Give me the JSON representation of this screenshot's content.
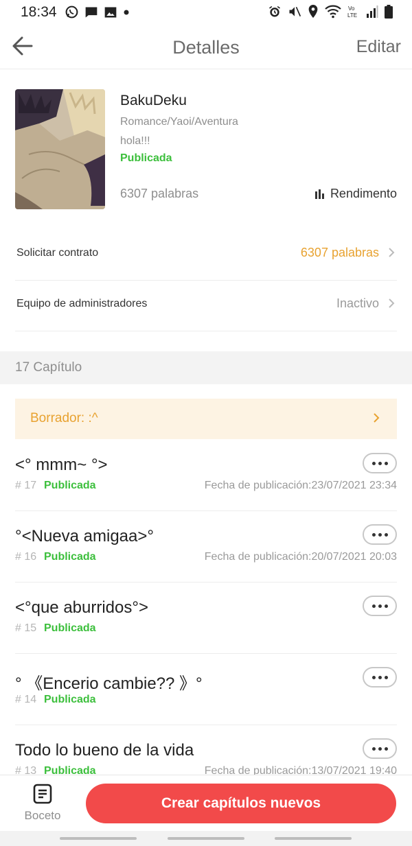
{
  "status_bar": {
    "time": "18:34",
    "left_icons": [
      "whatsapp-icon",
      "message-icon",
      "gallery-icon",
      "dot-icon"
    ],
    "right_icons": [
      "alarm-icon",
      "mute-icon",
      "location-icon",
      "wifi-icon",
      "volte-icon",
      "signal-icon",
      "battery-icon"
    ]
  },
  "header": {
    "title": "Detalles",
    "edit_label": "Editar",
    "back_icon": "arrow-left-icon"
  },
  "book": {
    "title": "BakuDeku",
    "genre": "Romance/Yaoi/Aventura",
    "description": "hola!!!",
    "status": "Publicada",
    "word_count": "6307 palabras",
    "performance_label": "Rendimento"
  },
  "settings": [
    {
      "label": "Solicitar contrato",
      "value": "6307 palabras",
      "value_color": "#e8a230"
    },
    {
      "label": "Equipo de administradores",
      "value": "Inactivo",
      "value_color": "#9a9a9a"
    }
  ],
  "chapters_header": "17 Capítulo",
  "draft": {
    "label": "Borrador: :^"
  },
  "chapters": [
    {
      "title": "<° mmm~ °>",
      "number": "# 17",
      "status": "Publicada",
      "date": "Fecha de publicación:23/07/2021 23:34"
    },
    {
      "title": "°<Nueva amigaa>°",
      "number": "# 16",
      "status": "Publicada",
      "date": "Fecha de publicación:20/07/2021 20:03"
    },
    {
      "title": "<°que aburridos°>",
      "number": "# 15",
      "status": "Publicada",
      "date": ""
    },
    {
      "title": "° 《Encerio cambie?? 》°",
      "number": "# 14",
      "status": "Publicada",
      "date": ""
    },
    {
      "title": "Todo lo bueno de la vida",
      "number": "# 13",
      "status": "Publicada",
      "date": "Fecha de publicación:13/07/2021 19:40"
    }
  ],
  "bottom": {
    "draft_tab_label": "Boceto",
    "create_button_label": "Crear capítulos nuevos"
  },
  "colors": {
    "accent_red": "#f24a4a",
    "published_green": "#3cbf3c",
    "orange": "#e8a230"
  }
}
